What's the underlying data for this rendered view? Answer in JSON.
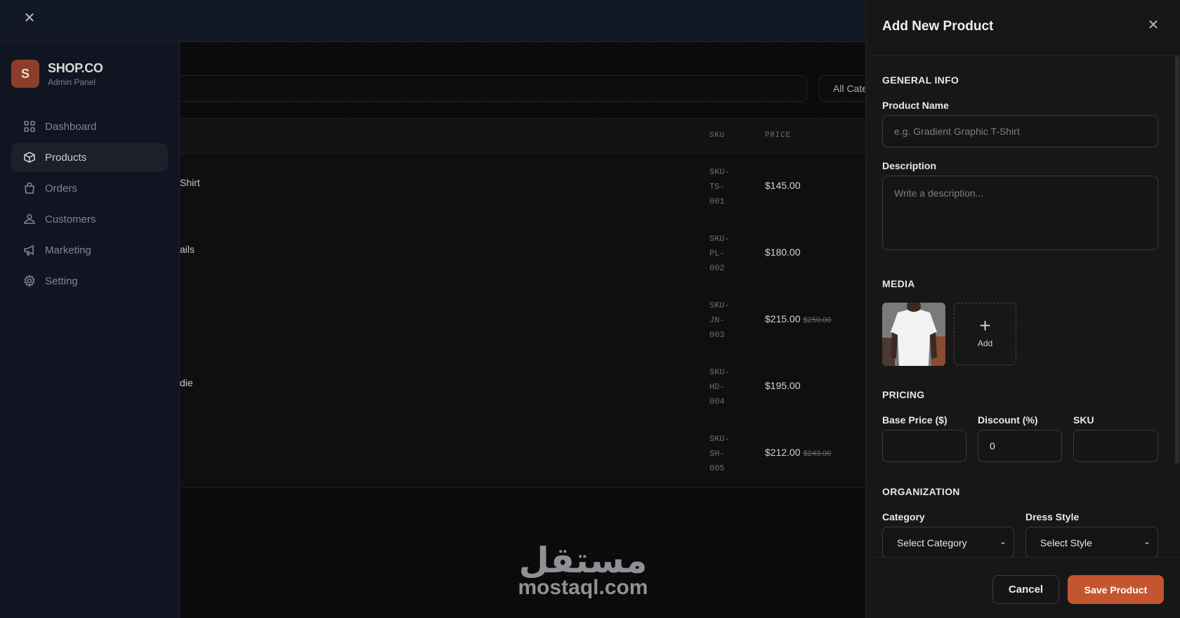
{
  "sidebar": {
    "brand_initial": "S",
    "brand_name": "SHOP.CO",
    "brand_sub": "Admin Panel",
    "items": [
      {
        "label": "Dashboard",
        "icon": "grid-icon"
      },
      {
        "label": "Products",
        "icon": "box-icon",
        "active": true
      },
      {
        "label": "Orders",
        "icon": "bag-icon"
      },
      {
        "label": "Customers",
        "icon": "users-icon"
      },
      {
        "label": "Marketing",
        "icon": "megaphone-icon"
      },
      {
        "label": "Setting",
        "icon": "gear-icon"
      }
    ]
  },
  "toolbar": {
    "category_filter": "All Cate"
  },
  "table": {
    "headers": {
      "sku": "SKU",
      "price": "PRICE"
    },
    "rows": [
      {
        "name": "Shirt",
        "sku": "SKU-TS-001",
        "price": "$145.00",
        "old_price": ""
      },
      {
        "name": "ails",
        "sku": "SKU-PL-002",
        "price": "$180.00",
        "old_price": ""
      },
      {
        "name": "",
        "sku": "SKU-JN-003",
        "price": "$215.00",
        "old_price": "$250.00"
      },
      {
        "name": "die",
        "sku": "SKU-HD-004",
        "price": "$195.00",
        "old_price": ""
      },
      {
        "name": "",
        "sku": "SKU-SH-005",
        "price": "$212.00",
        "old_price": "$243.00"
      }
    ]
  },
  "watermark": {
    "arabic": "مستقل",
    "latin": "mostaql.com"
  },
  "drawer": {
    "title": "Add New Product",
    "general": {
      "heading": "GENERAL INFO",
      "name_label": "Product Name",
      "name_placeholder": "e.g. Gradient Graphic T-Shirt",
      "desc_label": "Description",
      "desc_placeholder": "Write a description..."
    },
    "media": {
      "heading": "MEDIA",
      "add_label": "Add",
      "thumb_alt": "White T-Shirt"
    },
    "pricing": {
      "heading": "PRICING",
      "base_label": "Base Price ($)",
      "base_value": "",
      "discount_label": "Discount (%)",
      "discount_value": "0",
      "sku_label": "SKU",
      "sku_value": ""
    },
    "organization": {
      "heading": "ORGANIZATION",
      "category_label": "Category",
      "category_value": "Select Category",
      "style_label": "Dress Style",
      "style_value": "Select Style"
    },
    "cancel_label": "Cancel",
    "save_label": "Save Product"
  }
}
